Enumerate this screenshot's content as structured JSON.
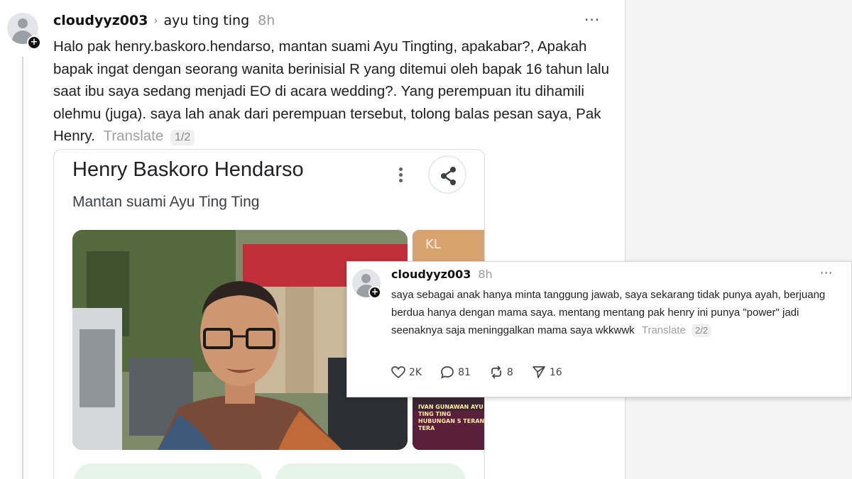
{
  "post": {
    "username": "cloudyyz003",
    "chevron": "›",
    "reply_to": "ayu ting ting",
    "time": "8h",
    "more": "···",
    "text": "Halo pak henry.baskoro.hendarso, mantan suami Ayu Tingting, apakabar?, Apakah bapak ingat dengan seorang wanita berinisial R yang ditemui oleh bapak 16 tahun lalu saat ibu saya sedang menjadi EO di acara wedding?. Yang perempuan itu dihamili olehmu (juga). saya lah anak dari perempuan tersebut, tolong balas pesan saya, Pak Henry.",
    "translate": "Translate",
    "page": "1/2"
  },
  "card": {
    "title": "Henry Baskoro Hendarso",
    "subtitle": "Mantan suami Ayu Ting Ting",
    "side_logo": "KL",
    "side_caption": "IVAN GUNAWAN AYU TING TING HUBUNGAN S TERANG TERA"
  },
  "reply": {
    "username": "cloudyyz003",
    "time": "8h",
    "more": "···",
    "text": "saya sebagai anak hanya minta tanggung jawab, saya sekarang tidak punya ayah, berjuang berdua hanya dengan mama saya. mentang mentang pak henry ini punya \"power\" jadi seenaknya saja meninggalkan mama saya wkkwwk",
    "translate": "Translate",
    "page": "2/2",
    "likes": "2K",
    "comments": "81",
    "reposts": "8",
    "shares": "16"
  },
  "colors": {
    "chip_green": "#e6f4ea",
    "side_panel": "#f4f4f4"
  },
  "icons": [
    "person-icon",
    "plus-icon",
    "share-icon",
    "kebab-icon",
    "heart-icon",
    "comment-icon",
    "repost-icon",
    "send-icon"
  ]
}
